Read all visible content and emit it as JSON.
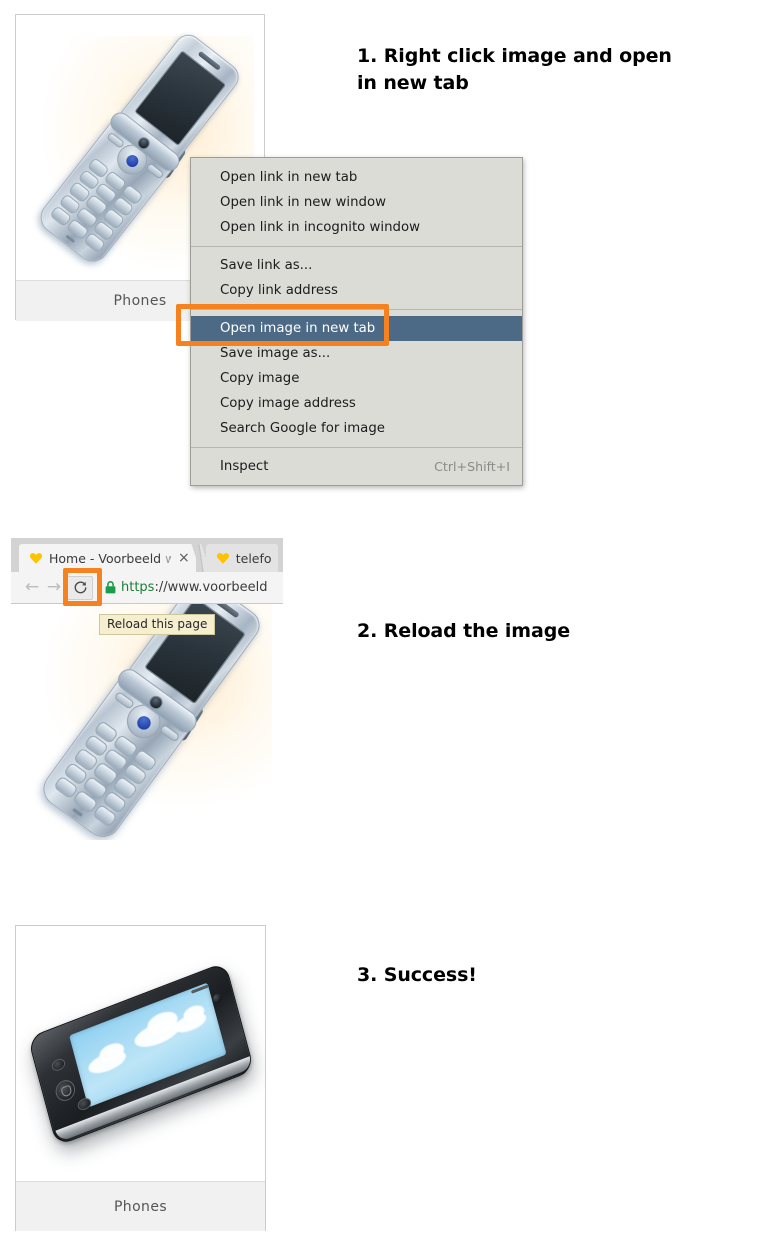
{
  "page": {
    "title": "Open image in new tab and reload instructions",
    "background": "#ffffff"
  },
  "colors": {
    "accent_orange": "#f5821f",
    "menu_highlight_blue": "#4c6a85",
    "menu_background": "#dcdcd7",
    "tooltip_background": "#f5efcf",
    "url_secure_green": "#1a7f37",
    "favicon_yellow": "#fdc300"
  },
  "steps": [
    {
      "number": "1.",
      "text": "1. Right click image and open in new tab"
    },
    {
      "number": "2.",
      "text": "2. Reload the image"
    },
    {
      "number": "3.",
      "text": "3. Success!"
    }
  ],
  "cards": {
    "first": {
      "caption": "Phones",
      "image_alt": "silver flip phone",
      "image_icon": "flip-phone-icon"
    },
    "third": {
      "caption": "Phones",
      "image_alt": "black smartphone with blue sky wallpaper",
      "image_icon": "smartphone-icon"
    }
  },
  "context_menu": {
    "groups": [
      {
        "items": [
          {
            "label": "Open link in new tab",
            "shortcut": "",
            "highlighted": false
          },
          {
            "label": "Open link in new window",
            "shortcut": "",
            "highlighted": false
          },
          {
            "label": "Open link in incognito window",
            "shortcut": "",
            "highlighted": false
          }
        ]
      },
      {
        "items": [
          {
            "label": "Save link as...",
            "shortcut": "",
            "highlighted": false
          },
          {
            "label": "Copy link address",
            "shortcut": "",
            "highlighted": false
          }
        ]
      },
      {
        "items": [
          {
            "label": "Open image in new tab",
            "shortcut": "",
            "highlighted": true
          },
          {
            "label": "Save image as...",
            "shortcut": "",
            "highlighted": false
          },
          {
            "label": "Copy image",
            "shortcut": "",
            "highlighted": false
          },
          {
            "label": "Copy image address",
            "shortcut": "",
            "highlighted": false
          },
          {
            "label": "Search Google for image",
            "shortcut": "",
            "highlighted": false
          }
        ]
      },
      {
        "items": [
          {
            "label": "Inspect",
            "shortcut": "Ctrl+Shift+I",
            "highlighted": false
          }
        ]
      }
    ]
  },
  "browser": {
    "tabs": [
      {
        "title_main": "Home - Voorbeeld ",
        "title_faded": "we",
        "favicon": "heart-favicon",
        "active": true,
        "close_glyph": "×"
      },
      {
        "title_main": "telefo",
        "title_faded": "",
        "favicon": "heart-favicon",
        "active": false,
        "close_glyph": ""
      }
    ],
    "toolbar": {
      "back_glyph": "←",
      "forward_glyph": "→",
      "reload_icon": "reload-icon",
      "reload_tooltip": "Reload this page",
      "lock_icon": "lock-icon",
      "url_scheme": "https",
      "url_rest": "://www.voorbeeld"
    }
  },
  "annotations": [
    {
      "name": "menu-item-highlight-box",
      "color": "#f5821f"
    },
    {
      "name": "reload-button-highlight-box",
      "color": "#f5821f"
    }
  ]
}
